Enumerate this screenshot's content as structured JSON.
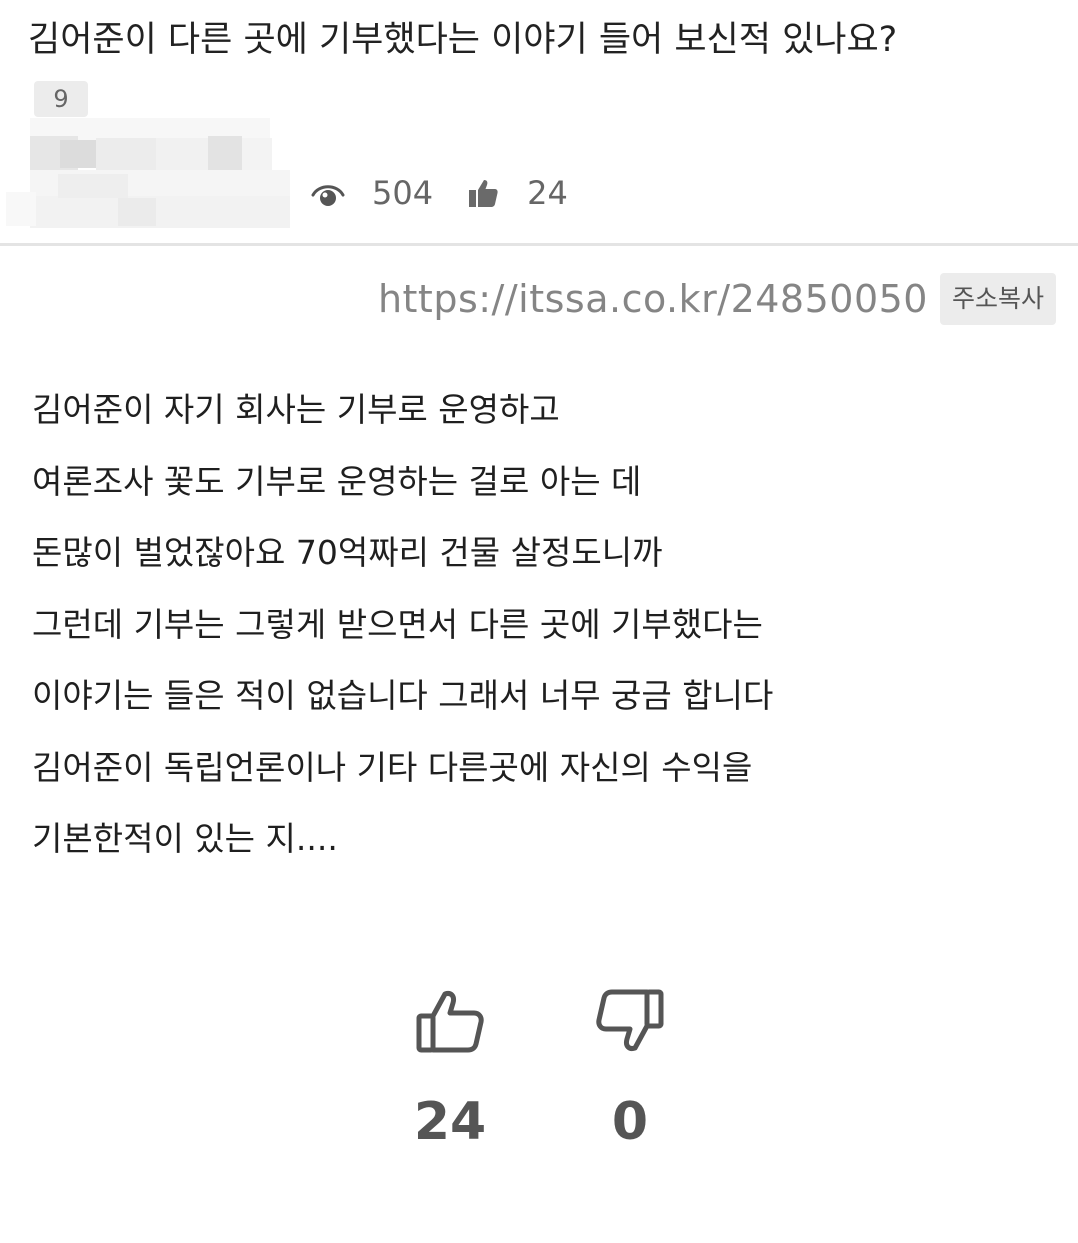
{
  "post": {
    "title": "김어준이 다른 곳에 기부했다는 이야기 들어 보신적 있나요?",
    "level_badge": "9",
    "views": "504",
    "likes": "24"
  },
  "share": {
    "url": "https://itssa.co.kr/24850050",
    "copy_label": "주소복사"
  },
  "body": {
    "lines": [
      "김어준이 자기 회사는 기부로 운영하고",
      "여론조사 꽃도 기부로 운영하는 걸로 아는 데",
      "돈많이 벌었잖아요 70억짜리 건물 살정도니까",
      "그런데 기부는 그렇게 받으면서 다른 곳에 기부했다는",
      "이야기는 들은 적이 없습니다 그래서 너무 궁금 합니다",
      "김어준이 독립언론이나 기타 다른곳에 자신의 수익을",
      "기본한적이 있는 지...."
    ]
  },
  "votes": {
    "upvotes": "24",
    "downvotes": "0"
  },
  "icons": {
    "views": "eye-icon",
    "likes": "thumbs-up-icon",
    "upvote": "thumbs-up-outline-icon",
    "downvote": "thumbs-down-outline-icon"
  },
  "colors": {
    "text": "#222222",
    "muted": "#666666",
    "badge_bg": "#ececec",
    "divider": "#e4e4e4"
  }
}
